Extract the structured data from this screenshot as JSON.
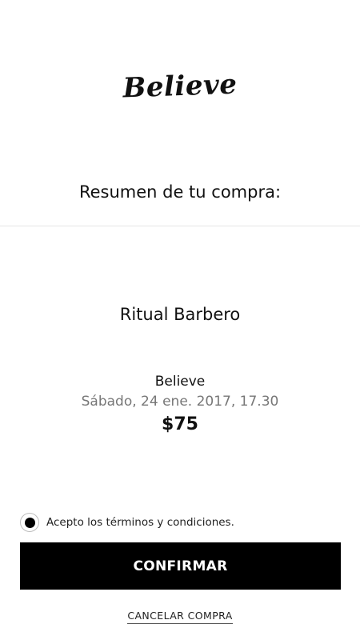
{
  "brand": {
    "logo_text": "Believe"
  },
  "summary": {
    "title": "Resumen de tu compra:"
  },
  "purchase": {
    "service": "Ritual Barbero",
    "venue": "Believe",
    "datetime": "Sábado, 24 ene. 2017, 17.30",
    "price": "$75"
  },
  "terms": {
    "label": "Acepto los términos y condiciones.",
    "checked": true
  },
  "actions": {
    "confirm_label": "CONFIRMAR",
    "cancel_label": "CANCELAR COMPRA"
  },
  "colors": {
    "primary_button": "#000000",
    "background": "#ffffff",
    "muted_text": "#777777"
  }
}
